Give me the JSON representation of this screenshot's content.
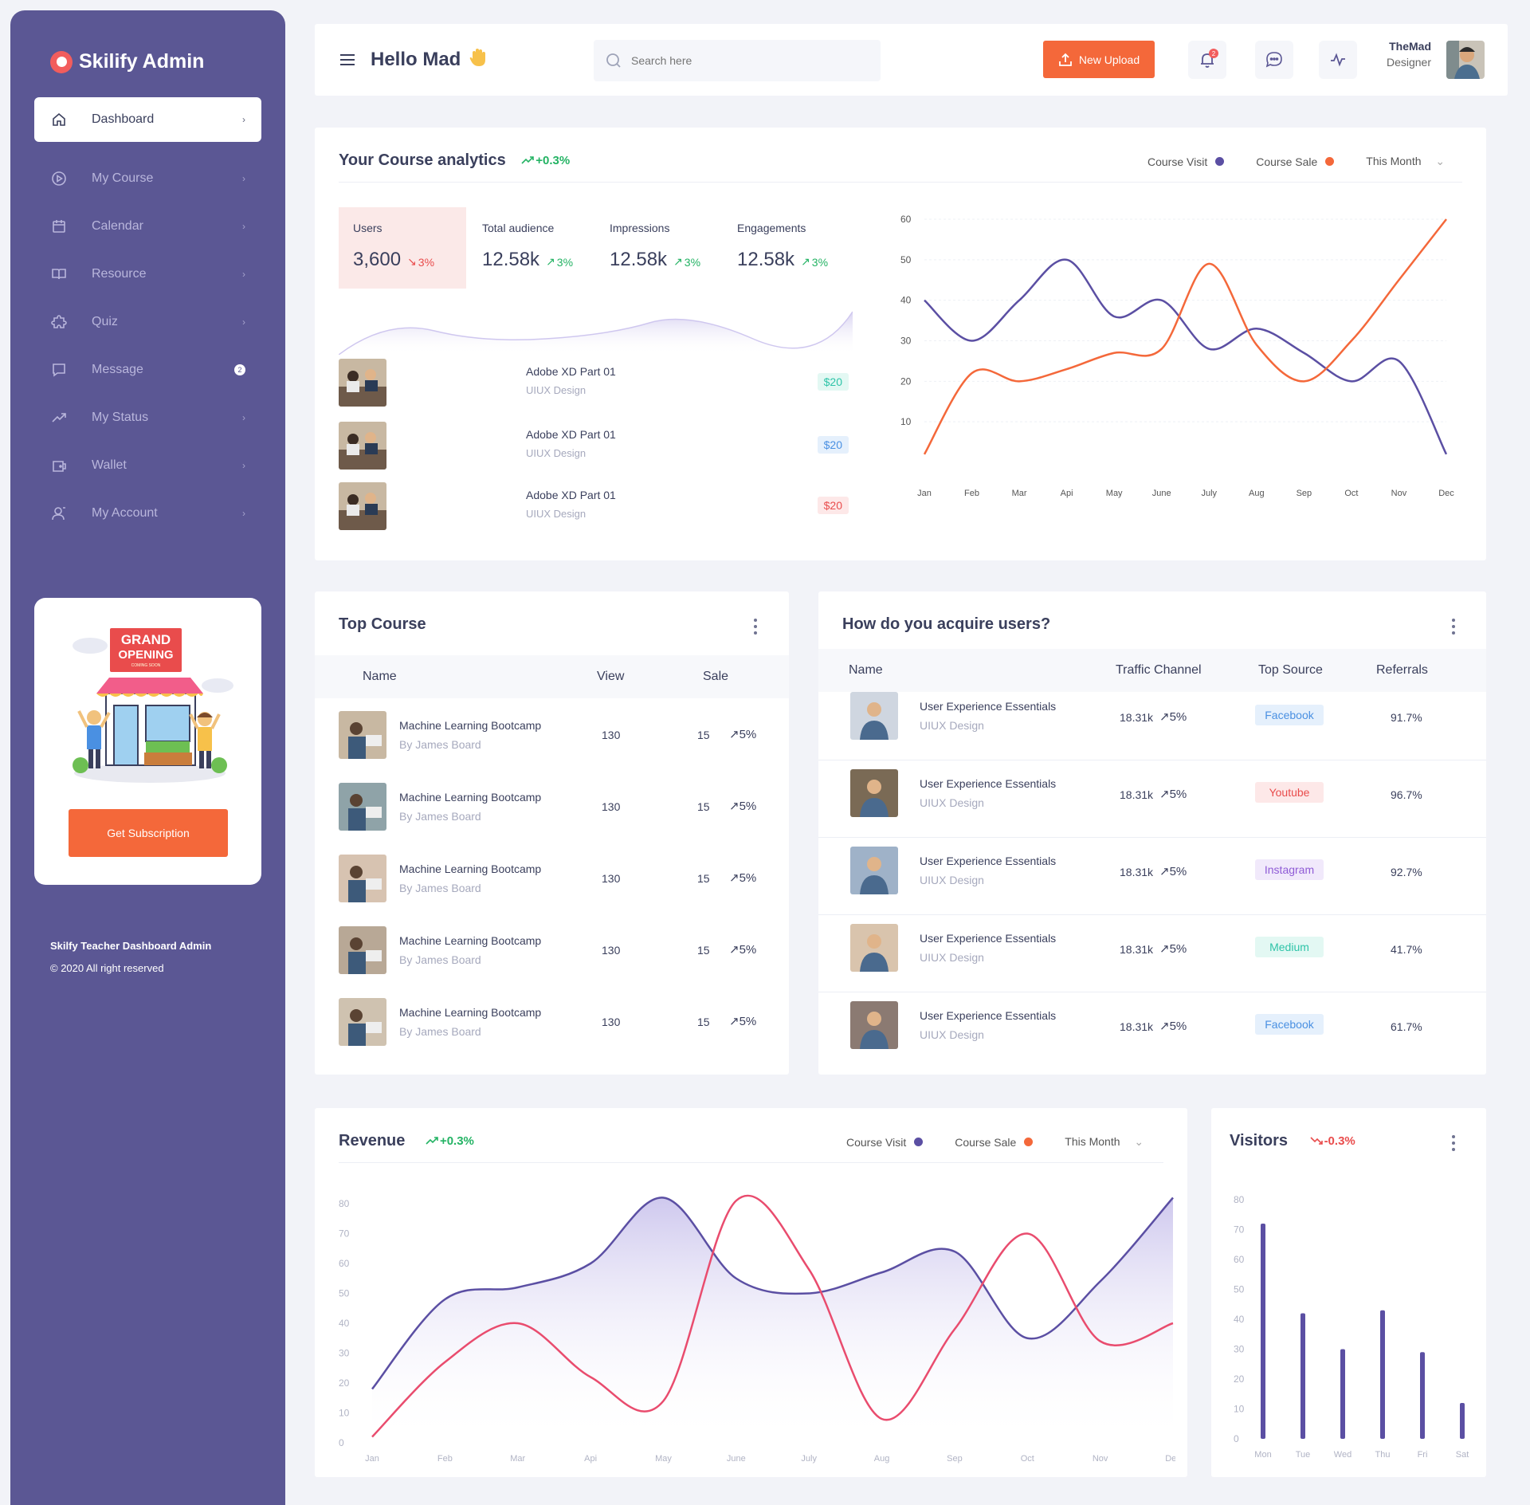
{
  "brand": {
    "name": "Skilify Admin"
  },
  "sidebar": {
    "items": [
      {
        "label": "Dashboard",
        "icon": "home-icon"
      },
      {
        "label": "My Course",
        "icon": "play-circle-icon"
      },
      {
        "label": "Calendar",
        "icon": "calendar-icon"
      },
      {
        "label": "Resource",
        "icon": "book-icon"
      },
      {
        "label": "Quiz",
        "icon": "puzzle-icon"
      },
      {
        "label": "Message",
        "icon": "chat-icon",
        "badge": "2"
      },
      {
        "label": "My Status",
        "icon": "trend-icon"
      },
      {
        "label": "Wallet",
        "icon": "wallet-icon"
      },
      {
        "label": "My Account",
        "icon": "user-icon"
      }
    ],
    "promo": {
      "sign_line1": "GRAND",
      "sign_line2": "OPENING",
      "sign_line3": "COMING SOON",
      "button": "Get Subscription"
    },
    "footer": {
      "line1": "Skilfy Teacher Dashboard Admin",
      "line2": "© 2020 All right reserved"
    }
  },
  "header": {
    "greeting": "Hello Mad",
    "search_placeholder": "Search here",
    "upload_label": "New Upload",
    "notification_badge": "2",
    "user_name": "TheMad",
    "user_role": "Designer"
  },
  "analytics": {
    "title": "Your Course analytics",
    "trend": "+0.3%",
    "legend": {
      "visit": "Course Visit",
      "sale": "Course Sale",
      "period": "This Month"
    },
    "stats": [
      {
        "label": "Users",
        "value": "3,600",
        "trend": "3%",
        "direction": "down"
      },
      {
        "label": "Total audience",
        "value": "12.58k",
        "trend": "3%",
        "direction": "up"
      },
      {
        "label": "Impressions",
        "value": "12.58k",
        "trend": "3%",
        "direction": "up"
      },
      {
        "label": "Engagements",
        "value": "12.58k",
        "trend": "3%",
        "direction": "up"
      }
    ],
    "courses": [
      {
        "title": "Adobe XD Part 01",
        "subtitle": "UIUX Design",
        "price": "$20",
        "color": "#2ec4a8",
        "bg": "#e3f8f3"
      },
      {
        "title": "Adobe XD Part 01",
        "subtitle": "UIUX Design",
        "price": "$20",
        "color": "#4a90e2",
        "bg": "#e5f0fc"
      },
      {
        "title": "Adobe XD Part 01",
        "subtitle": "UIUX Design",
        "price": "$20",
        "color": "#e94c4c",
        "bg": "#fde8e8"
      }
    ]
  },
  "top_course": {
    "title": "Top Course",
    "columns": [
      "Name",
      "View",
      "Sale"
    ],
    "rows": [
      {
        "title": "Machine Learning Bootcamp",
        "author": "By James Board",
        "view": "130",
        "sale": "15",
        "trend": "5%"
      },
      {
        "title": "Machine Learning Bootcamp",
        "author": "By James Board",
        "view": "130",
        "sale": "15",
        "trend": "5%"
      },
      {
        "title": "Machine Learning Bootcamp",
        "author": "By James Board",
        "view": "130",
        "sale": "15",
        "trend": "5%"
      },
      {
        "title": "Machine Learning Bootcamp",
        "author": "By James Board",
        "view": "130",
        "sale": "15",
        "trend": "5%"
      },
      {
        "title": "Machine Learning Bootcamp",
        "author": "By James Board",
        "view": "130",
        "sale": "15",
        "trend": "5%"
      }
    ]
  },
  "acquire": {
    "title": "How do you acquire users?",
    "columns": [
      "Name",
      "Traffic Channel",
      "Top Source",
      "Referrals"
    ],
    "rows": [
      {
        "title": "User Experience Essentials",
        "subtitle": "UIUX Design",
        "traffic": "18.31k",
        "trend": "5%",
        "source": "Facebook",
        "source_color": "#4a90e2",
        "source_bg": "#e5f0fc",
        "referrals": "91.7%"
      },
      {
        "title": "User Experience Essentials",
        "subtitle": "UIUX Design",
        "traffic": "18.31k",
        "trend": "5%",
        "source": "Youtube",
        "source_color": "#e94c4c",
        "source_bg": "#fde8e8",
        "referrals": "96.7%"
      },
      {
        "title": "User Experience Essentials",
        "subtitle": "UIUX Design",
        "traffic": "18.31k",
        "trend": "5%",
        "source": "Instagram",
        "source_color": "#8f5bd6",
        "source_bg": "#f1e9fb",
        "referrals": "92.7%"
      },
      {
        "title": "User Experience Essentials",
        "subtitle": "UIUX Design",
        "traffic": "18.31k",
        "trend": "5%",
        "source": "Medium",
        "source_color": "#2ec4a8",
        "source_bg": "#e3f8f3",
        "referrals": "41.7%"
      },
      {
        "title": "User Experience Essentials",
        "subtitle": "UIUX Design",
        "traffic": "18.31k",
        "trend": "5%",
        "source": "Facebook",
        "source_color": "#4a90e2",
        "source_bg": "#e5f0fc",
        "referrals": "61.7%"
      }
    ]
  },
  "revenue": {
    "title": "Revenue",
    "trend": "+0.3%",
    "legend": {
      "visit": "Course Visit",
      "sale": "Course Sale",
      "period": "This Month"
    }
  },
  "visitors": {
    "title": "Visitors",
    "trend": "-0.3%"
  },
  "colors": {
    "accent": "#5b5794",
    "orange": "#f4683a",
    "visit_line": "#5b4fa3",
    "sale_line": "#f4683a",
    "revenue_sale": "#e94c6e",
    "up": "#24b364",
    "down": "#e94c4c"
  },
  "chart_data": [
    {
      "type": "line",
      "categories": [
        "Jan",
        "Feb",
        "Mar",
        "Api",
        "May",
        "June",
        "July",
        "Aug",
        "Sep",
        "Oct",
        "Nov",
        "Dec"
      ],
      "series": [
        {
          "name": "Course Visit",
          "values": [
            40,
            30,
            40,
            50,
            36,
            40,
            28,
            33,
            27,
            20,
            25,
            2
          ]
        },
        {
          "name": "Course Sale",
          "values": [
            2,
            22,
            20,
            23,
            27,
            28,
            49,
            29,
            20,
            30,
            45,
            60
          ]
        }
      ],
      "yticks": [
        10,
        20,
        30,
        40,
        50,
        60
      ],
      "ylim": [
        0,
        60
      ]
    },
    {
      "type": "area",
      "categories": [
        "Jan",
        "Feb",
        "Mar",
        "Api",
        "May",
        "June",
        "July",
        "Aug",
        "Sep",
        "Oct",
        "Nov",
        "Dec"
      ],
      "series": [
        {
          "name": "Course Visit",
          "values": [
            18,
            48,
            52,
            60,
            82,
            55,
            50,
            57,
            64,
            35,
            54,
            82
          ]
        },
        {
          "name": "Course Sale",
          "values": [
            2,
            27,
            40,
            22,
            14,
            81,
            58,
            8,
            38,
            70,
            34,
            40
          ]
        }
      ],
      "yticks": [
        0,
        10,
        20,
        30,
        40,
        50,
        60,
        70,
        80
      ],
      "ylim": [
        0,
        80
      ]
    },
    {
      "type": "bar",
      "categories": [
        "Mon",
        "Tue",
        "Wed",
        "Thu",
        "Fri",
        "Sat"
      ],
      "values": [
        72,
        42,
        30,
        43,
        29,
        12
      ],
      "yticks": [
        0,
        10,
        20,
        30,
        40,
        50,
        60,
        70,
        80
      ],
      "ylim": [
        0,
        80
      ]
    }
  ]
}
